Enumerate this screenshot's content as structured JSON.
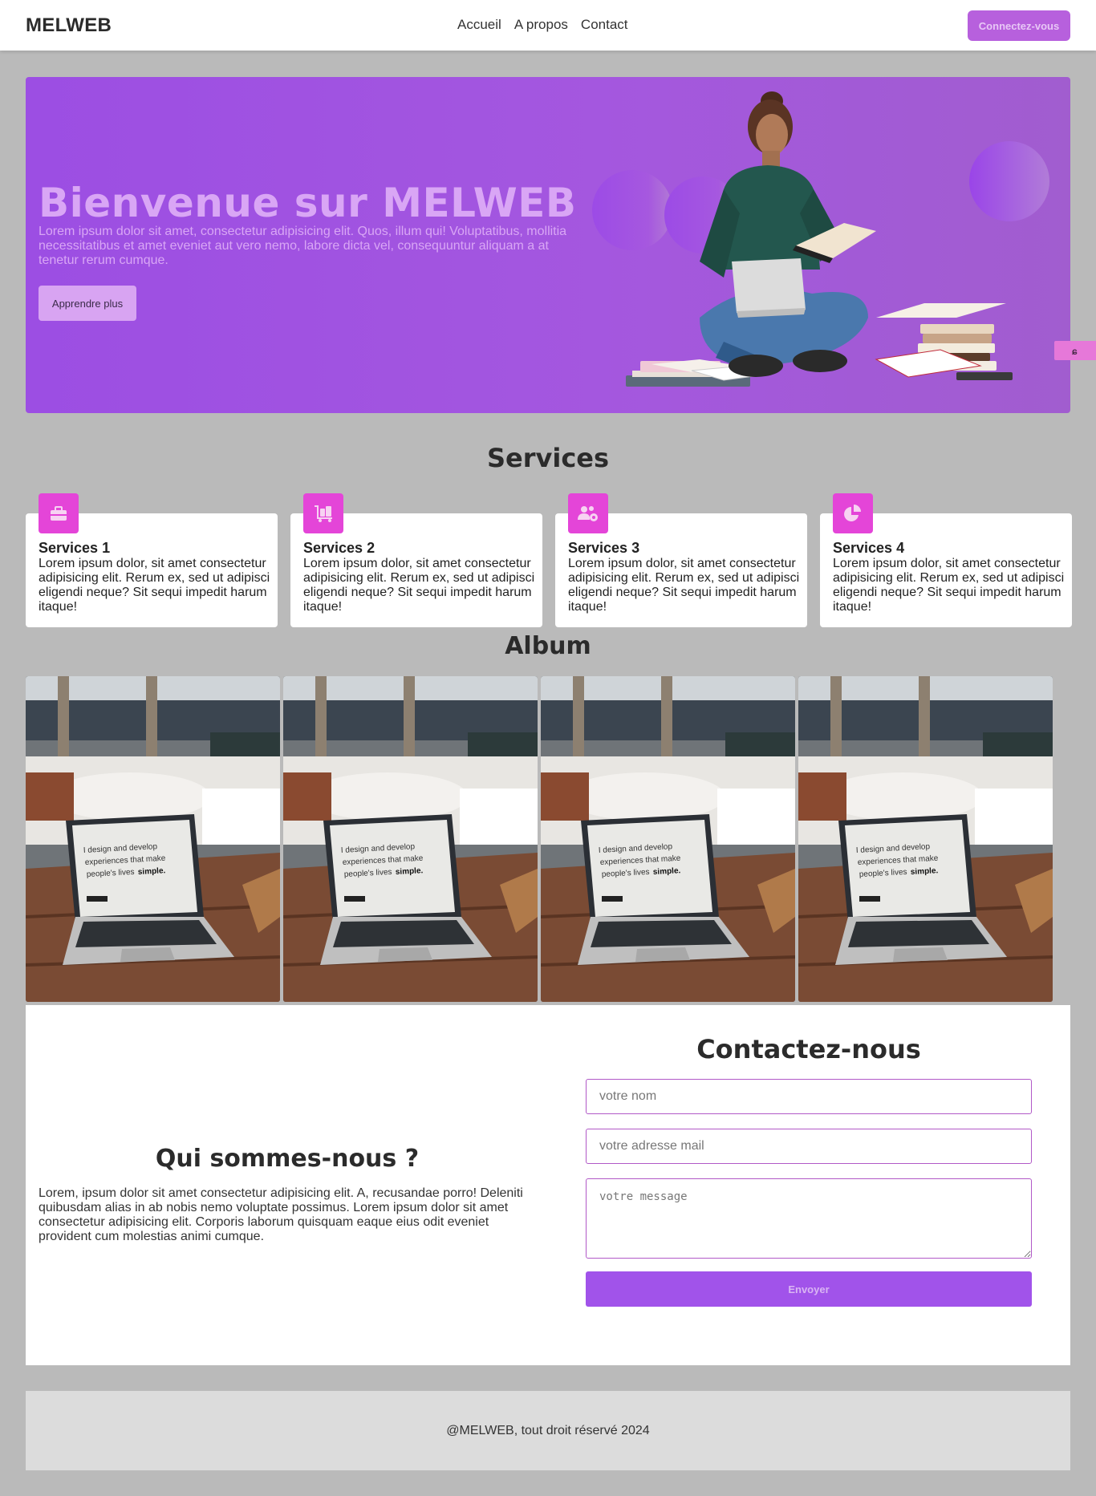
{
  "nav": {
    "brand": "MELWEB",
    "links": [
      "Accueil",
      "A propos",
      "Contact"
    ],
    "login_label": "Connectez-vous"
  },
  "hero": {
    "title": "Bienvenue sur MELWEB",
    "text": "Lorem ipsum dolor sit amet, consectetur adipisicing elit. Quos, illum qui! Voluptatibus, mollitia necessitatibus et amet eveniet aut vero nemo, labore dicta vel, consequuntur aliquam a at tenetur rerum cumque.",
    "button_label": "Apprendre plus"
  },
  "services": {
    "title": "Services",
    "items": [
      {
        "title": "Services 1",
        "icon": "briefcase-icon",
        "text": "Lorem ipsum dolor, sit amet consectetur adipisicing elit. Rerum ex, sed ut adipisci eligendi neque? Sit sequi impedit harum itaque!"
      },
      {
        "title": "Services 2",
        "icon": "luggage-cart-icon",
        "text": "Lorem ipsum dolor, sit amet consectetur adipisicing elit. Rerum ex, sed ut adipisci eligendi neque? Sit sequi impedit harum itaque!"
      },
      {
        "title": "Services 3",
        "icon": "users-cog-icon",
        "text": "Lorem ipsum dolor, sit amet consectetur adipisicing elit. Rerum ex, sed ut adipisci eligendi neque? Sit sequi impedit harum itaque!"
      },
      {
        "title": "Services 4",
        "icon": "chart-pie-icon",
        "text": "Lorem ipsum dolor, sit amet consectetur adipisicing elit. Rerum ex, sed ut adipisci eligendi neque? Sit sequi impedit harum itaque!"
      }
    ]
  },
  "album": {
    "title": "Album",
    "screen_text_1": "I design and develop",
    "screen_text_2": "experiences that make",
    "screen_text_3": "people's lives",
    "screen_text_bold": "simple."
  },
  "about": {
    "title": "Qui sommes-nous ?",
    "text": "Lorem, ipsum dolor sit amet consectetur adipisicing elit. A, recusandae porro! Deleniti quibusdam alias in ab nobis nemo voluptate possimus. Lorem ipsum dolor sit amet consectetur adipisicing elit. Corporis laborum quisquam eaque eius odit eveniet provident cum molestias animi cumque."
  },
  "contact": {
    "title": "Contactez-nous",
    "name_placeholder": "votre nom",
    "email_placeholder": "votre adresse mail",
    "message_placeholder": "votre message",
    "send_label": "Envoyer"
  },
  "footer": {
    "text": "@MELWEB, tout droit réservé 2024"
  },
  "colors": {
    "accent": "#a153ea",
    "icon_bg": "#e445d8",
    "page_bg": "#bababa"
  }
}
